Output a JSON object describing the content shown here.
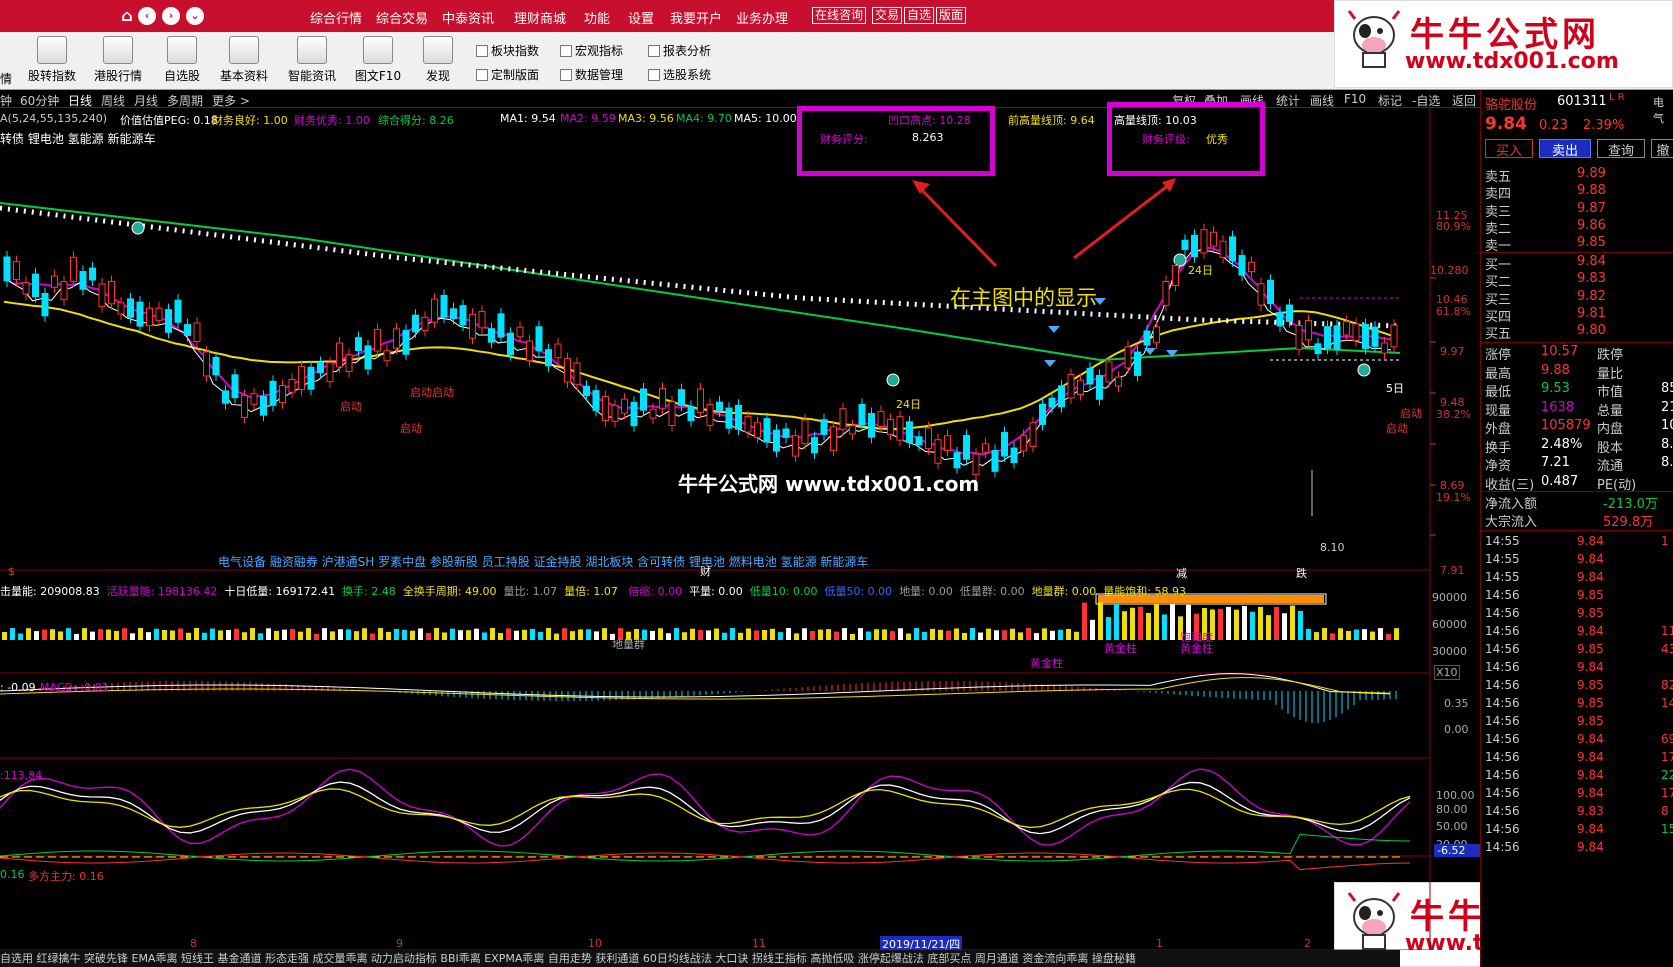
{
  "menu": {
    "items": [
      "综合行情",
      "综合交易",
      "中泰资讯",
      "理财商城",
      "功能",
      "设置",
      "我要开户",
      "业务办理"
    ],
    "boxed": [
      "在线咨询",
      "交易",
      "自选",
      "版面"
    ]
  },
  "toolbar": {
    "buttons": [
      "股转指数",
      "港股行情",
      "自选股",
      "基本资料",
      "智能资讯",
      "图文F10",
      "发现"
    ],
    "small": [
      "板块指数",
      "宏观指标",
      "报表分析",
      "定制版面",
      "数据管理",
      "选股系统"
    ],
    "left_cut": "情"
  },
  "logo": {
    "title": "牛牛公式网",
    "url": "www.tdx001.com"
  },
  "periods": [
    "钟",
    "60分钟",
    "日线",
    "周线",
    "月线",
    "多周期",
    "更多 >"
  ],
  "right_tools": [
    "复权",
    "叠加",
    "画线",
    "统计",
    "画线",
    "F10",
    "标记",
    "-自选",
    "返回"
  ],
  "main": {
    "ma_params": "A(5,24,55,135,240)",
    "line1": [
      "价值估值PEG: 0.18",
      "财务良好: 1.00",
      "财务优秀: 1.00",
      "综合得分: 8.26",
      "MA1: 9.54",
      "MA2: 9.59",
      "MA3: 9.56",
      "MA4: 9.70",
      "MA5: 10.00",
      "凹口高点: 10.28",
      "前高量线顶: 9.64",
      "高量线顶: 10.03"
    ],
    "concepts": "转债 锂电池 氢能源 新能源车",
    "box1": {
      "label": "财务评分:",
      "value": "8.263"
    },
    "box2": {
      "label": "财务评级:",
      "value": "优秀"
    },
    "annotation": "在主图中的显示",
    "watermark": "牛牛公式网 www.tdx001.com",
    "bottom_concepts": "电气设备 融资融券 沪港通SH 罗素中盘 参股新股 员工持股 证金持股 湖北板块 含可转债 锂电池 燃料电池 氢能源 新能源车",
    "markers": {
      "cai": "财",
      "jian": "减",
      "die": "跌",
      "s": "$",
      "low": "8.10",
      "d24a": "24日",
      "d24b": "24日",
      "d5": "5日"
    },
    "qidong": [
      "启动",
      "启动",
      "启动",
      "启动",
      "启动",
      "启动"
    ],
    "y_axis": [
      "11.25",
      "80.9%",
      "10.280",
      "10.46",
      "61.8%",
      "9.97",
      "9.48",
      "38.2%",
      "8.69",
      "19.1%",
      "7.91"
    ]
  },
  "volume": {
    "line": [
      "击量能: 209008.83",
      "活跃量能: 198136.42",
      "十日低量: 169172.41",
      "换手: 2.48",
      "全换手周期: 49.00",
      "量比: 1.07",
      "量倍: 1.07",
      "倍缩: 0.00",
      "平量: 0.00",
      "低量10: 0.00",
      "低量50: 0.00",
      "地量: 0.00",
      "低量群: 0.00",
      "地量群: 0.00",
      "量能饱和: 58.93"
    ],
    "dlq": "地量群",
    "y": [
      "90000",
      "60000",
      "30000",
      "X10"
    ],
    "tags": [
      "黄金柱",
      "黄金柱",
      "饱和度",
      "黄金柱"
    ]
  },
  "macd": {
    "line": [
      ": -0.09",
      "MACD: -0.01"
    ],
    "y": [
      "0.35",
      "0.00"
    ]
  },
  "kdj": {
    "line": ":113.84",
    "y": [
      "100.00",
      "80.00",
      "50.00",
      "20.00"
    ],
    "badge": "-6.52"
  },
  "dfzl": {
    "line": [
      "0.16",
      "多方主力: 0.16"
    ]
  },
  "x_axis": [
    "8",
    "9",
    "10",
    "11",
    "2019/11/21/四",
    "1",
    "2"
  ],
  "bottom_tabs": "自选用 红绿擒牛 突破先锋 EMA乖离 短线王 基金通道 形态走强 成交量乖离 动力启动指标 BBI乖离 EXPMA乖离 自用走势 获利通道 60日均线战法 大口诀 拐线王指标 高抛低吸 涨停起爆战法 底部买点 周月通道 资金流向乖离 操盘秘籍",
  "quote": {
    "name": "骆驼股份",
    "code": "601311",
    "flag": "L R",
    "price": "9.84",
    "change": "0.23",
    "pct": "2.39%",
    "btns": [
      "买入",
      "卖出",
      "查询",
      "撤"
    ],
    "asks": [
      [
        "卖五",
        "9.89"
      ],
      [
        "卖四",
        "9.88"
      ],
      [
        "卖三",
        "9.87"
      ],
      [
        "卖二",
        "9.86"
      ],
      [
        "卖一",
        "9.85"
      ]
    ],
    "bids": [
      [
        "买一",
        "9.84"
      ],
      [
        "买二",
        "9.83"
      ],
      [
        "买三",
        "9.82"
      ],
      [
        "买四",
        "9.81"
      ],
      [
        "买五",
        "9.80"
      ]
    ],
    "stats": [
      [
        "涨停",
        "10.57",
        "跌停",
        ""
      ],
      [
        "最高",
        "9.88",
        "量比",
        ""
      ],
      [
        "最低",
        "9.53",
        "市值",
        "85"
      ],
      [
        "现量",
        "1638",
        "总量",
        "21"
      ],
      [
        "外盘",
        "105879",
        "内盘",
        "10"
      ],
      [
        "换手",
        "2.48%",
        "股本",
        "8."
      ],
      [
        "净资",
        "7.21",
        "流通",
        "8."
      ],
      [
        "收益(三)",
        "0.487",
        "PE(动)",
        ""
      ]
    ],
    "flows": [
      [
        "净流入额",
        "-213.0万"
      ],
      [
        "大宗流入",
        "529.8万"
      ]
    ],
    "ticks": [
      [
        "14:55",
        "9.84",
        "1"
      ],
      [
        "14:55",
        "9.84",
        ""
      ],
      [
        "14:55",
        "9.84",
        ""
      ],
      [
        "14:56",
        "9.85",
        ""
      ],
      [
        "14:56",
        "9.85",
        ""
      ],
      [
        "14:56",
        "9.84",
        "11"
      ],
      [
        "14:56",
        "9.85",
        "43"
      ],
      [
        "14:56",
        "9.84",
        ""
      ],
      [
        "14:56",
        "9.85",
        "82"
      ],
      [
        "14:56",
        "9.85",
        "14"
      ],
      [
        "14:56",
        "9.85",
        ""
      ],
      [
        "14:56",
        "9.84",
        "69"
      ],
      [
        "14:56",
        "9.84",
        "17"
      ],
      [
        "14:56",
        "9.84",
        "22"
      ],
      [
        "14:56",
        "9.84",
        "173"
      ],
      [
        "14:56",
        "9.83",
        "8"
      ],
      [
        "14:56",
        "9.84",
        "15"
      ],
      [
        "14:56",
        "9.84",
        ""
      ]
    ],
    "topcut": "电气"
  },
  "colors": {
    "red": "#ff3333",
    "green": "#00cc44",
    "magenta": "#d400d4",
    "yellow": "#f0e000"
  }
}
